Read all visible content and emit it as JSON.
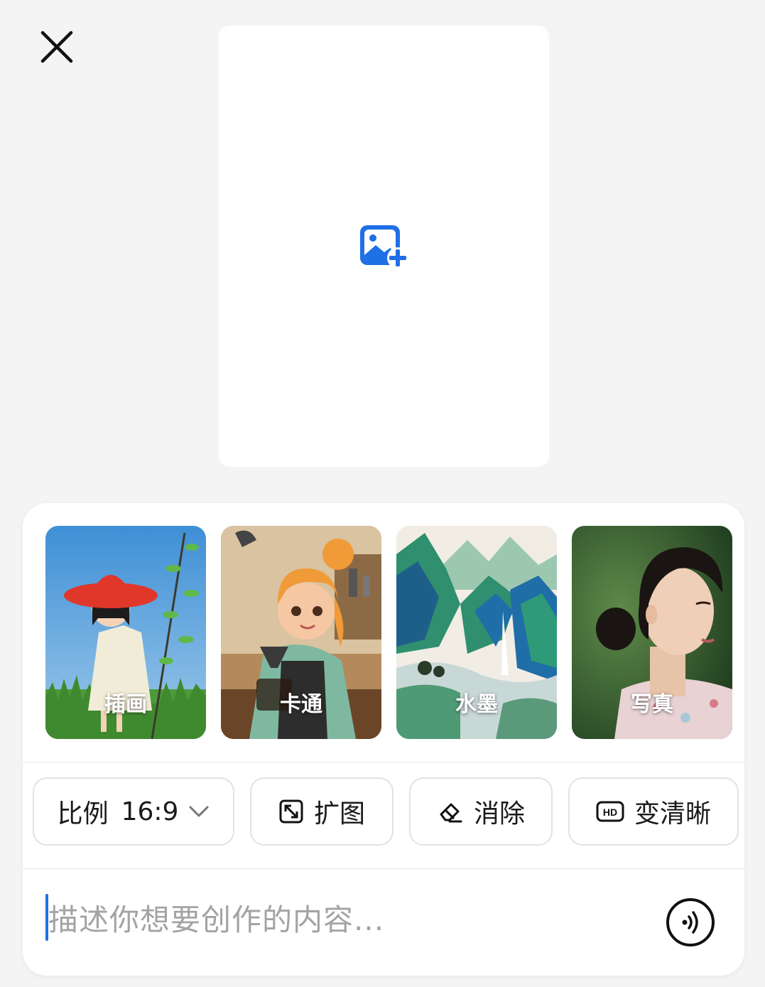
{
  "top_bar": {
    "close_icon": "close-icon"
  },
  "canvas": {
    "add_icon": "add-image-icon",
    "accent": "#1f6fe5"
  },
  "styles": [
    {
      "label": "插画",
      "icon": "illustration-thumbnail"
    },
    {
      "label": "卡通",
      "icon": "cartoon-thumbnail"
    },
    {
      "label": "水墨",
      "icon": "ink-painting-thumbnail"
    },
    {
      "label": "写真",
      "icon": "portrait-thumbnail"
    }
  ],
  "tools": {
    "ratio_label": "比例",
    "ratio_value": "16:9",
    "expand_label": "扩图",
    "erase_label": "消除",
    "enhance_label": "变清晰"
  },
  "prompt": {
    "placeholder": "描述你想要创作的内容..."
  }
}
